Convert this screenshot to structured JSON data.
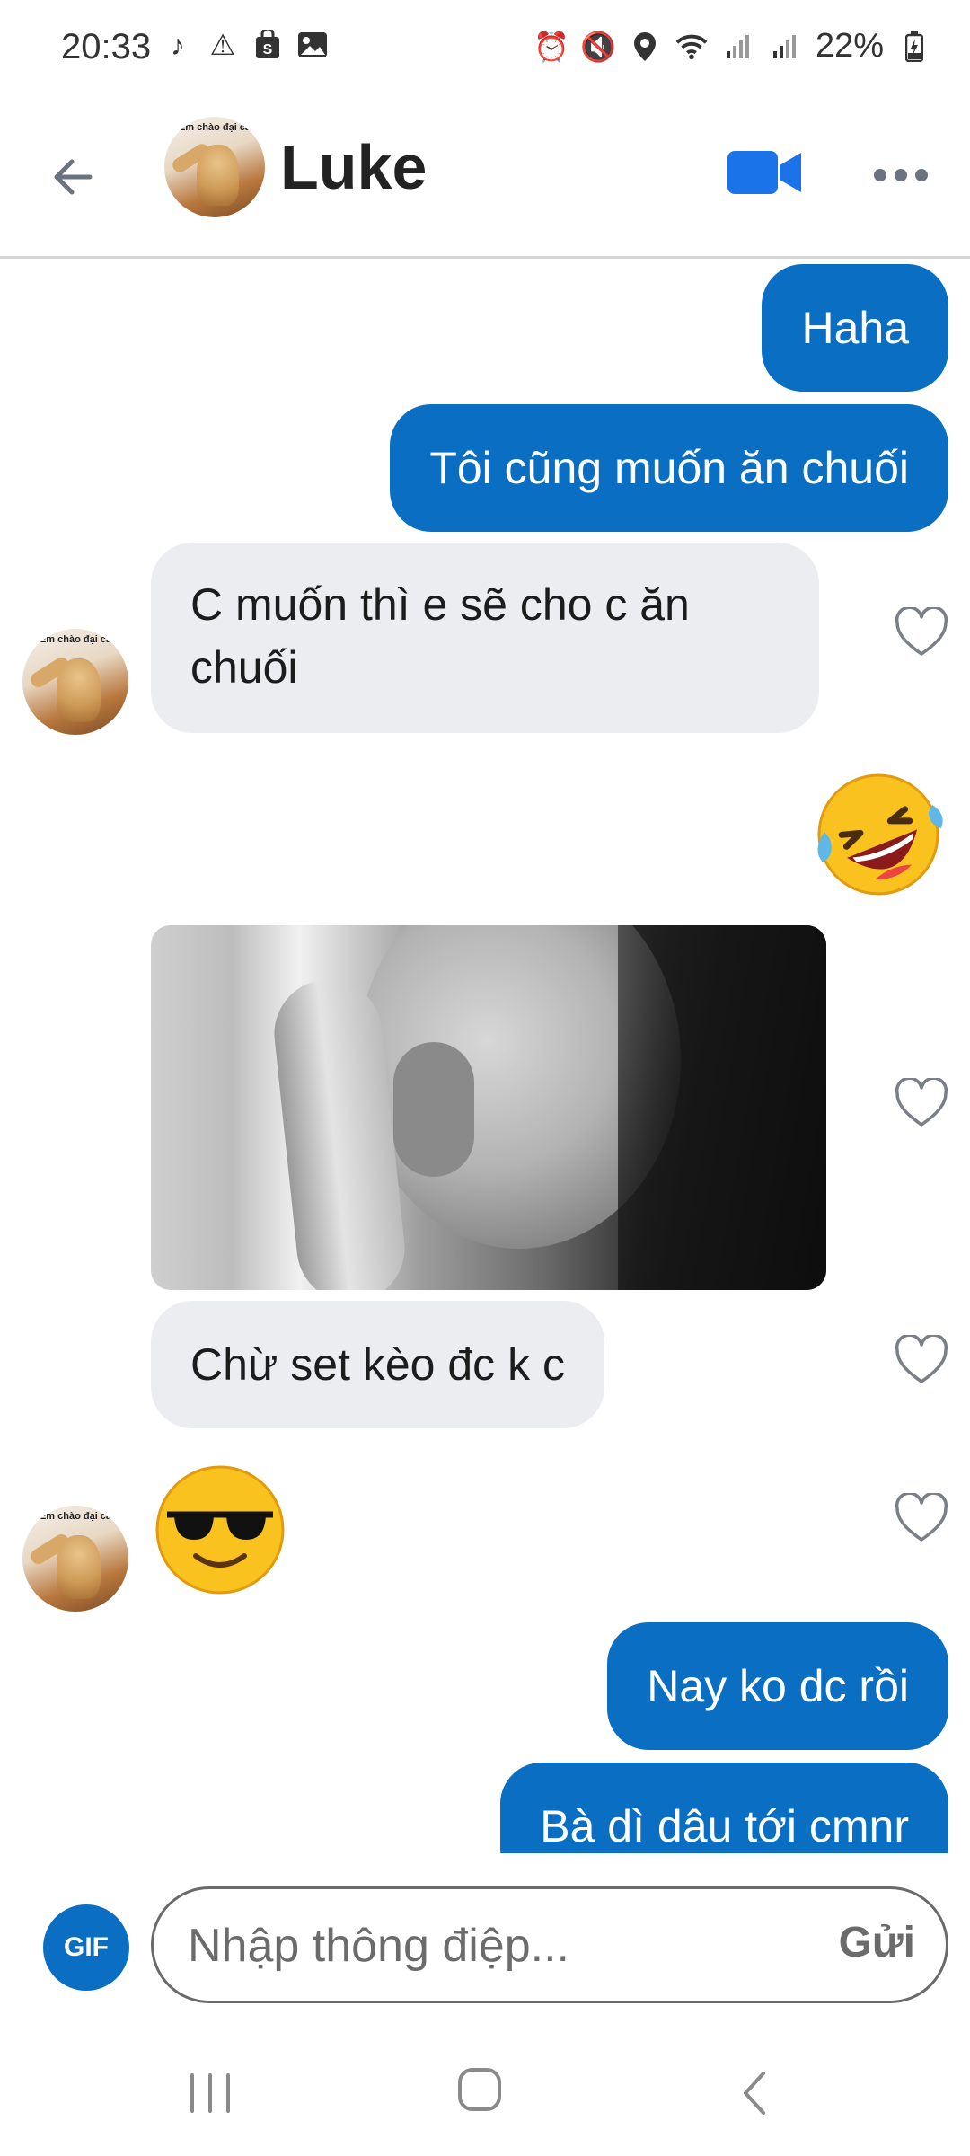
{
  "status_bar": {
    "time": "20:33",
    "battery": "22%",
    "left_icons": [
      "tiktok-icon",
      "warning-icon",
      "shopping-bag-icon",
      "image-icon"
    ],
    "right_icons": [
      "alarm-icon",
      "mute-icon",
      "location-icon",
      "wifi-icon",
      "signal-icon",
      "signal-icon",
      "battery-charging-icon"
    ]
  },
  "header": {
    "contact_name": "Luke",
    "avatar_caption": "Em chào đại ca",
    "accent_color": "#1a73e8"
  },
  "messages": [
    {
      "id": 1,
      "direction": "sent",
      "type": "text",
      "text": "Haha"
    },
    {
      "id": 2,
      "direction": "sent",
      "type": "text",
      "text": "Tôi cũng muốn ăn chuối"
    },
    {
      "id": 3,
      "direction": "received",
      "type": "text",
      "text": "C muốn thì e sẽ cho c ăn chuối"
    },
    {
      "id": 4,
      "direction": "sent",
      "type": "emoji",
      "emoji": "rolling-on-floor-laughing"
    },
    {
      "id": 5,
      "direction": "received",
      "type": "image",
      "text": ""
    },
    {
      "id": 6,
      "direction": "received",
      "type": "text",
      "text": "Chừ set kèo đc k c"
    },
    {
      "id": 7,
      "direction": "received",
      "type": "emoji",
      "emoji": "sunglasses-face"
    },
    {
      "id": 8,
      "direction": "sent",
      "type": "text",
      "text": "Nay ko dc rồi"
    },
    {
      "id": 9,
      "direction": "sent",
      "type": "text",
      "text": "Bà dì dâu tới cmnr"
    }
  ],
  "composer": {
    "gif_label": "GIF",
    "placeholder": "Nhập thông điệp...",
    "send_label": "Gửi"
  },
  "colors": {
    "sent_bubble": "#0a6fc2",
    "received_bubble": "#ebedf0"
  }
}
